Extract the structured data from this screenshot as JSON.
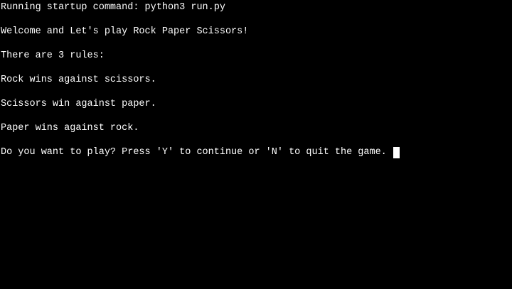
{
  "terminal": {
    "startup_line": "Running startup command: python3 run.py",
    "lines": [
      "Welcome and Let's play Rock Paper Scissors!",
      "There are 3 rules:",
      "Rock wins against scissors.",
      "Scissors win against paper.",
      "Paper wins against rock."
    ],
    "prompt": "Do you want to play? Press 'Y' to continue or 'N' to quit the game.",
    "colors": {
      "background": "#000000",
      "text": "#ffffff",
      "cursor": "#ffffff"
    }
  }
}
